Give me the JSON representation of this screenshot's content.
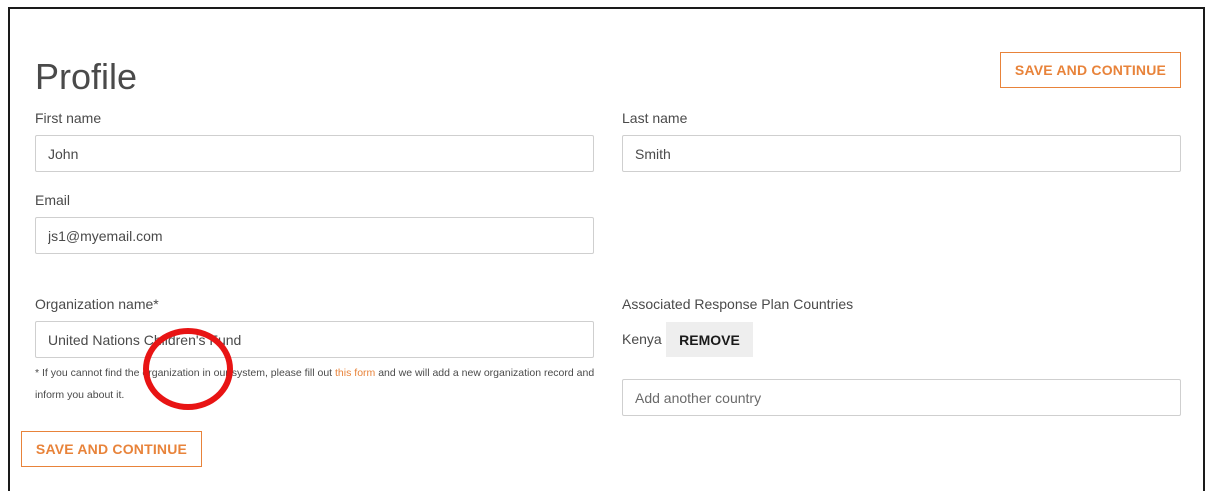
{
  "page": {
    "title": "Profile",
    "save_label": "SAVE AND CONTINUE"
  },
  "form": {
    "first_name": {
      "label": "First name",
      "value": "John"
    },
    "last_name": {
      "label": "Last name",
      "value": "Smith"
    },
    "email": {
      "label": "Email",
      "value": "js1@myemail.com"
    },
    "organization": {
      "label": "Organization name*",
      "value": "United Nations Children's Fund",
      "note_prefix": "* If you cannot find the organization in our system, please fill out ",
      "note_link": "this form",
      "note_suffix": " and we will add a new organization record and inform you about it."
    },
    "countries": {
      "label": "Associated Response Plan Countries",
      "selected": [
        "Kenya"
      ],
      "remove_label": "REMOVE",
      "add_placeholder": "Add another country"
    }
  },
  "colors": {
    "accent": "#e8833a",
    "annotation": "#e81414"
  }
}
